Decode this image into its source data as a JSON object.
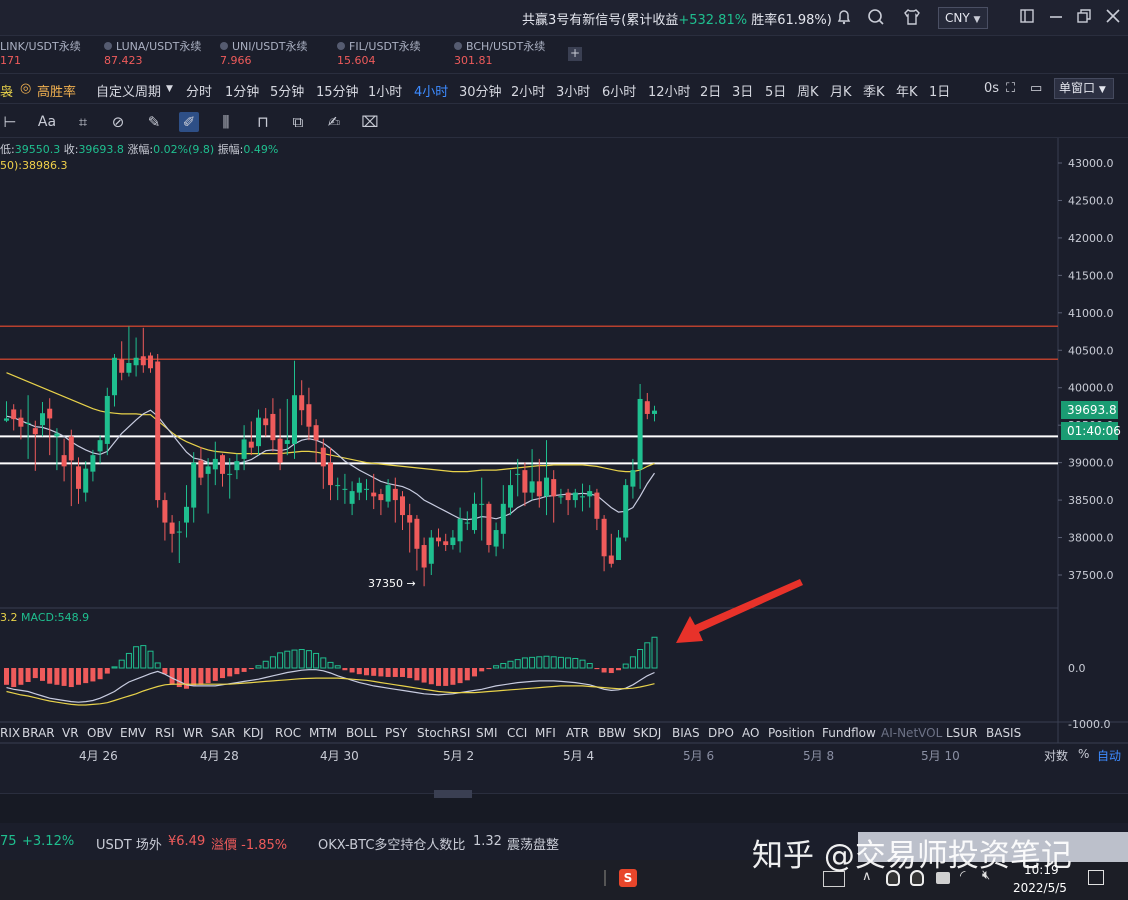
{
  "titlebar": {
    "title_prefix": "共赢3号有新信号(累计收益",
    "title_gain": "+532.81%",
    "title_suffix": " 胜率61.98%)",
    "currency": "CNY"
  },
  "tabs": [
    {
      "name": "LINK/USDT永续",
      "price": "171"
    },
    {
      "name": "LUNA/USDT永续",
      "price": "87.423"
    },
    {
      "name": "UNI/USDT永续",
      "price": "7.966"
    },
    {
      "name": "FIL/USDT永续",
      "price": "15.604"
    },
    {
      "name": "BCH/USDT永续",
      "price": "301.81"
    }
  ],
  "add_tab_label": "+",
  "periodbar": {
    "first": "袅",
    "win_rate": "高胜率",
    "custom": "自定义周期",
    "periods": [
      "分时",
      "1分钟",
      "5分钟",
      "15分钟",
      "1小时",
      "4小时",
      "30分钟",
      "2小时",
      "3小时",
      "6小时",
      "12小时",
      "2日",
      "3日",
      "5日",
      "周K",
      "月K",
      "季K",
      "年K",
      "1日"
    ],
    "active_period": "4小时",
    "zero_s": "0s",
    "window_select": "单窗口"
  },
  "ohlc": {
    "low_label": "低:",
    "low": "39550.3",
    "close_label": "收:",
    "close": "39693.8",
    "chg_label": "涨幅:",
    "chg": "0.02%(9.8)",
    "amp_label": "振幅:",
    "amp": "0.49%"
  },
  "ma_line": "50):38986.3",
  "macd": {
    "prefix": "3.2",
    "label": "MACD:548.9"
  },
  "price_axis": [
    "43000.0",
    "42500.0",
    "42000.0",
    "41500.0",
    "41000.0",
    "40500.0",
    "40000.0",
    "39500.0",
    "39000.0",
    "38500.0",
    "38000.0",
    "37500.0"
  ],
  "macd_axis": [
    "0.0",
    "-1000.0"
  ],
  "last_price": "39693.8",
  "countdown": "01:40:06",
  "low_annotation": "37350",
  "indicators": [
    "RIX",
    "BRAR",
    "VR",
    "OBV",
    "EMV",
    "RSI",
    "WR",
    "SAR",
    "KDJ",
    "ROC",
    "MTM",
    "BOLL",
    "PSY",
    "StochRSI",
    "SMI",
    "CCI",
    "MFI",
    "ATR",
    "BBW",
    "SKDJ",
    "BIAS",
    "DPO",
    "AO",
    "Position",
    "Fundflow",
    "AI-NetVOL",
    "LSUR",
    "BASIS"
  ],
  "dates": [
    "4月 26",
    "4月 28",
    "4月 30",
    "5月 2",
    "5月 4",
    "5月 6",
    "5月 8",
    "5月 10"
  ],
  "axis_opts": {
    "log": "对数",
    "pct": "%",
    "auto": "自动"
  },
  "ticker": {
    "t1": "75",
    "t1_chg": "+3.12%",
    "usdt_label": "USDT 场外",
    "usdt_price": "¥6.49",
    "premium": "溢價 -1.85%",
    "okx_label": "OKX-BTC多空持仓人数比",
    "okx_val": "1.32",
    "okx_state": "震荡盘整"
  },
  "watermark": "知乎 @交易师投资笔记",
  "taskbar": {
    "time": "10:19",
    "date": "2022/5/5"
  },
  "colors": {
    "up": "#1fbf8f",
    "down": "#ef5b5b",
    "accent": "#3d8bff",
    "ma_yellow": "#e8d24a"
  },
  "chart_data": {
    "type": "candlestick",
    "y_range": [
      37100,
      43200
    ],
    "macd_range": [
      -1100,
      900
    ],
    "candles": [
      [
        39560,
        39590,
        39820,
        39540
      ],
      [
        39710,
        39580,
        39780,
        39430
      ],
      [
        39600,
        39480,
        39710,
        39310
      ],
      [
        39530,
        39530,
        39900,
        39050
      ],
      [
        39460,
        39380,
        39560,
        38890
      ],
      [
        39500,
        39660,
        39810,
        39350
      ],
      [
        39720,
        39590,
        39860,
        39100
      ],
      [
        39350,
        39390,
        39460,
        38900
      ],
      [
        39100,
        38950,
        39320,
        38750
      ],
      [
        39350,
        39030,
        39440,
        38420
      ],
      [
        38950,
        38650,
        39070,
        38450
      ],
      [
        38600,
        38920,
        39020,
        38480
      ],
      [
        38880,
        39100,
        39170,
        38750
      ],
      [
        39150,
        39300,
        39360,
        38990
      ],
      [
        39250,
        39890,
        40000,
        39100
      ],
      [
        39900,
        40400,
        40450,
        39750
      ],
      [
        40380,
        40200,
        40620,
        40100
      ],
      [
        40200,
        40330,
        40820,
        40150
      ],
      [
        40300,
        40400,
        40670,
        40150
      ],
      [
        40420,
        40300,
        40800,
        40200
      ],
      [
        40430,
        40260,
        40470,
        40200
      ],
      [
        40350,
        38500,
        40450,
        38400
      ],
      [
        38500,
        38200,
        38600,
        37960
      ],
      [
        38200,
        38050,
        38300,
        37800
      ],
      [
        38080,
        38080,
        38220,
        37660
      ],
      [
        38200,
        38410,
        38700,
        38000
      ],
      [
        38400,
        39000,
        39140,
        38200
      ],
      [
        39030,
        38800,
        39210,
        38700
      ],
      [
        38850,
        38950,
        39060,
        38320
      ],
      [
        38910,
        39050,
        39280,
        38700
      ],
      [
        39100,
        38850,
        39120,
        38680
      ],
      [
        38850,
        38850,
        39060,
        38520
      ],
      [
        38900,
        39020,
        39120,
        38780
      ],
      [
        39050,
        39310,
        39500,
        38900
      ],
      [
        39280,
        39200,
        39550,
        39100
      ],
      [
        39220,
        39600,
        39710,
        39100
      ],
      [
        39590,
        39500,
        39730,
        39350
      ],
      [
        39650,
        39300,
        39860,
        39150
      ],
      [
        39320,
        39000,
        39720,
        38900
      ],
      [
        39250,
        39300,
        39850,
        39100
      ],
      [
        39250,
        39900,
        40360,
        39050
      ],
      [
        39900,
        39700,
        40100,
        39500
      ],
      [
        39780,
        39480,
        40000,
        39300
      ],
      [
        39500,
        39300,
        39580,
        39000
      ],
      [
        39200,
        38950,
        39320,
        38650
      ],
      [
        39000,
        38700,
        39200,
        38500
      ],
      [
        38700,
        38700,
        38800,
        38500
      ],
      [
        38650,
        38650,
        38850,
        38450
      ],
      [
        38450,
        38620,
        38750,
        38300
      ],
      [
        38600,
        38730,
        38800,
        38500
      ],
      [
        38650,
        38650,
        38780,
        38500
      ],
      [
        38600,
        38550,
        38850,
        38380
      ],
      [
        38580,
        38500,
        38650,
        38300
      ],
      [
        38480,
        38700,
        38780,
        38400
      ],
      [
        38650,
        38500,
        38800,
        38200
      ],
      [
        38550,
        38300,
        38620,
        38100
      ],
      [
        38300,
        38200,
        38450,
        37800
      ],
      [
        38250,
        37850,
        38300,
        37560
      ],
      [
        37900,
        37600,
        38000,
        37350
      ],
      [
        37650,
        38000,
        38100,
        37500
      ],
      [
        38000,
        37950,
        38120,
        37880
      ],
      [
        37950,
        37900,
        38050,
        37820
      ],
      [
        37900,
        38000,
        38100,
        37840
      ],
      [
        37950,
        38250,
        38400,
        37800
      ],
      [
        38200,
        38200,
        38350,
        38100
      ],
      [
        38100,
        38450,
        38600,
        38050
      ],
      [
        38450,
        38450,
        38800,
        37960
      ],
      [
        38450,
        37900,
        38480,
        37800
      ],
      [
        37880,
        38100,
        38200,
        37750
      ],
      [
        38050,
        38450,
        38700,
        37850
      ],
      [
        38400,
        38700,
        38900,
        38300
      ],
      [
        38850,
        38850,
        39050,
        38550
      ],
      [
        38900,
        38600,
        39000,
        38420
      ],
      [
        38600,
        38750,
        39180,
        38500
      ],
      [
        38750,
        38550,
        39050,
        38400
      ],
      [
        38550,
        38800,
        39300,
        38300
      ],
      [
        38780,
        38550,
        38900,
        38200
      ],
      [
        38550,
        38550,
        38650,
        38450
      ],
      [
        38600,
        38500,
        38650,
        38300
      ],
      [
        38500,
        38600,
        38650,
        38400
      ],
      [
        38550,
        38550,
        38720,
        38350
      ],
      [
        38550,
        38620,
        38700,
        38400
      ],
      [
        38600,
        38250,
        38650,
        38100
      ],
      [
        38250,
        37750,
        38300,
        37550
      ],
      [
        37760,
        37650,
        38050,
        37600
      ],
      [
        37700,
        38000,
        38100,
        37700
      ],
      [
        38000,
        38700,
        38780,
        37950
      ],
      [
        38680,
        38900,
        39050,
        38520
      ],
      [
        38910,
        39850,
        40050,
        38650
      ],
      [
        39820,
        39650,
        39930,
        39580
      ],
      [
        39650,
        39694,
        39760,
        39550
      ]
    ],
    "ma_fast": [
      39620,
      39600,
      39560,
      39520,
      39480,
      39470,
      39440,
      39400,
      39350,
      39280,
      39220,
      39170,
      39130,
      39110,
      39150,
      39270,
      39390,
      39480,
      39570,
      39650,
      39700,
      39620,
      39500,
      39380,
      39260,
      39140,
      39060,
      39040,
      39000,
      38980,
      38980,
      38980,
      38990,
      39010,
      39040,
      39100,
      39160,
      39170,
      39160,
      39180,
      39250,
      39300,
      39320,
      39300,
      39260,
      39190,
      39110,
      39020,
      38960,
      38900,
      38850,
      38800,
      38750,
      38720,
      38700,
      38680,
      38640,
      38580,
      38500,
      38450,
      38400,
      38350,
      38300,
      38250,
      38240,
      38250,
      38280,
      38270,
      38250,
      38280,
      38320,
      38400,
      38450,
      38500,
      38520,
      38550,
      38560,
      38570,
      38580,
      38580,
      38590,
      38580,
      38560,
      38480,
      38400,
      38340,
      38350,
      38400,
      38550,
      38720,
      38860
    ],
    "ma_slow": [
      40200,
      40160,
      40120,
      40080,
      40040,
      40000,
      39960,
      39920,
      39880,
      39840,
      39800,
      39760,
      39720,
      39690,
      39670,
      39660,
      39650,
      39650,
      39650,
      39640,
      39640,
      39560,
      39480,
      39400,
      39330,
      39280,
      39240,
      39200,
      39170,
      39150,
      39140,
      39130,
      39120,
      39120,
      39120,
      39120,
      39120,
      39120,
      39120,
      39130,
      39140,
      39150,
      39150,
      39140,
      39120,
      39100,
      39080,
      39060,
      39040,
      39020,
      39000,
      38990,
      38980,
      38970,
      38960,
      38950,
      38940,
      38930,
      38920,
      38910,
      38900,
      38890,
      38880,
      38880,
      38880,
      38890,
      38900,
      38900,
      38900,
      38910,
      38920,
      38930,
      38940,
      38950,
      38960,
      38960,
      38970,
      38970,
      38970,
      38970,
      38970,
      38960,
      38950,
      38930,
      38910,
      38890,
      38880,
      38880,
      38900,
      38950,
      38990
    ],
    "macd_hist": [
      -300,
      -340,
      -300,
      -250,
      -180,
      -230,
      -280,
      -300,
      -320,
      -340,
      -300,
      -270,
      -240,
      -200,
      -100,
      20,
      140,
      260,
      380,
      400,
      300,
      90,
      -110,
      -300,
      -340,
      -370,
      -310,
      -300,
      -270,
      -230,
      -180,
      -150,
      -110,
      -70,
      -20,
      40,
      120,
      200,
      270,
      300,
      320,
      330,
      310,
      260,
      180,
      100,
      40,
      -40,
      -80,
      -110,
      -130,
      -140,
      -150,
      -160,
      -160,
      -160,
      -180,
      -220,
      -260,
      -290,
      -320,
      -320,
      -300,
      -270,
      -220,
      -150,
      -60,
      -20,
      40,
      80,
      120,
      150,
      180,
      190,
      200,
      210,
      200,
      190,
      180,
      170,
      140,
      80,
      -20,
      -80,
      -90,
      -40,
      70,
      200,
      330,
      450,
      549
    ],
    "macd_dif": [
      -350,
      -380,
      -400,
      -420,
      -460,
      -500,
      -540,
      -560,
      -580,
      -600,
      -610,
      -600,
      -580,
      -540,
      -480,
      -420,
      -330,
      -250,
      -200,
      -150,
      -100,
      -60,
      -110,
      -180,
      -240,
      -300,
      -320,
      -320,
      -320,
      -320,
      -300,
      -280,
      -260,
      -240,
      -220,
      -200,
      -170,
      -140,
      -110,
      -80,
      -60,
      -40,
      -30,
      -30,
      -50,
      -90,
      -140,
      -180,
      -220,
      -260,
      -290,
      -320,
      -340,
      -360,
      -380,
      -400,
      -420,
      -440,
      -460,
      -470,
      -480,
      -470,
      -460,
      -440,
      -420,
      -400,
      -380,
      -350,
      -320,
      -300,
      -280,
      -260,
      -250,
      -240,
      -230,
      -230,
      -230,
      -240,
      -250,
      -260,
      -280,
      -300,
      -340,
      -380,
      -400,
      -390,
      -360,
      -300,
      -220,
      -140,
      -80
    ],
    "macd_dea": [
      -420,
      -450,
      -480,
      -500,
      -530,
      -560,
      -590,
      -610,
      -630,
      -650,
      -660,
      -660,
      -650,
      -640,
      -620,
      -580,
      -540,
      -500,
      -460,
      -410,
      -370,
      -330,
      -300,
      -290,
      -290,
      -290,
      -290,
      -290,
      -290,
      -290,
      -290,
      -290,
      -280,
      -270,
      -260,
      -250,
      -240,
      -230,
      -220,
      -210,
      -200,
      -190,
      -185,
      -180,
      -180,
      -180,
      -180,
      -190,
      -200,
      -210,
      -220,
      -240,
      -260,
      -280,
      -300,
      -320,
      -340,
      -360,
      -380,
      -400,
      -420,
      -430,
      -440,
      -440,
      -440,
      -440,
      -430,
      -420,
      -410,
      -400,
      -390,
      -380,
      -370,
      -360,
      -350,
      -340,
      -330,
      -320,
      -320,
      -320,
      -320,
      -330,
      -340,
      -350,
      -360,
      -370,
      -370,
      -360,
      -340,
      -310,
      -280
    ],
    "levels": [
      40820,
      40380,
      39350,
      38990
    ],
    "candle_start_index": 0
  }
}
